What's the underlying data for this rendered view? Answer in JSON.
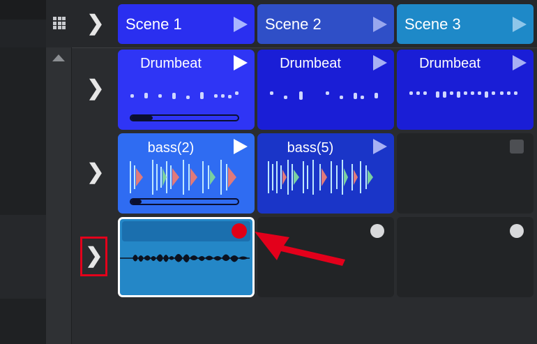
{
  "scenes": [
    {
      "label": "Scene 1",
      "color": "#2a2ff0"
    },
    {
      "label": "Scene 2",
      "color": "#2f4fc7"
    },
    {
      "label": "Scene 3",
      "color": "#1e89c8"
    }
  ],
  "clips": [
    {
      "name": "Drumbeat",
      "scene": "Scene 1",
      "color": "#2f35f5",
      "type": "midi",
      "playing": true,
      "progress": 0.2
    },
    {
      "name": "Drumbeat",
      "scene": "Scene 2",
      "color": "#1a1ed6",
      "type": "midi"
    },
    {
      "name": "Drumbeat",
      "scene": "Scene 3",
      "color": "#1a1ed6",
      "type": "midi"
    },
    {
      "name": "bass(2)",
      "scene": "Scene 1",
      "color": "#2f6cf2",
      "type": "audio",
      "playing": true,
      "progress": 0.1
    },
    {
      "name": "bass(5)",
      "scene": "Scene 2",
      "color": "#1a35c8",
      "type": "audio"
    }
  ],
  "recording_clip": {
    "scene": "Scene 1",
    "color": "#2487c7",
    "record_button_color": "#e00016",
    "selected": true
  },
  "icons": {
    "grid": "grid-icon",
    "chevron": "chevron-right-icon",
    "play": "play-icon",
    "stop": "stop-square-icon",
    "record": "record-dot-icon",
    "scroll_up": "scroll-up-arrow-icon"
  },
  "annotation": {
    "arrow_color": "#e3001b",
    "box_color": "#e3001b"
  }
}
